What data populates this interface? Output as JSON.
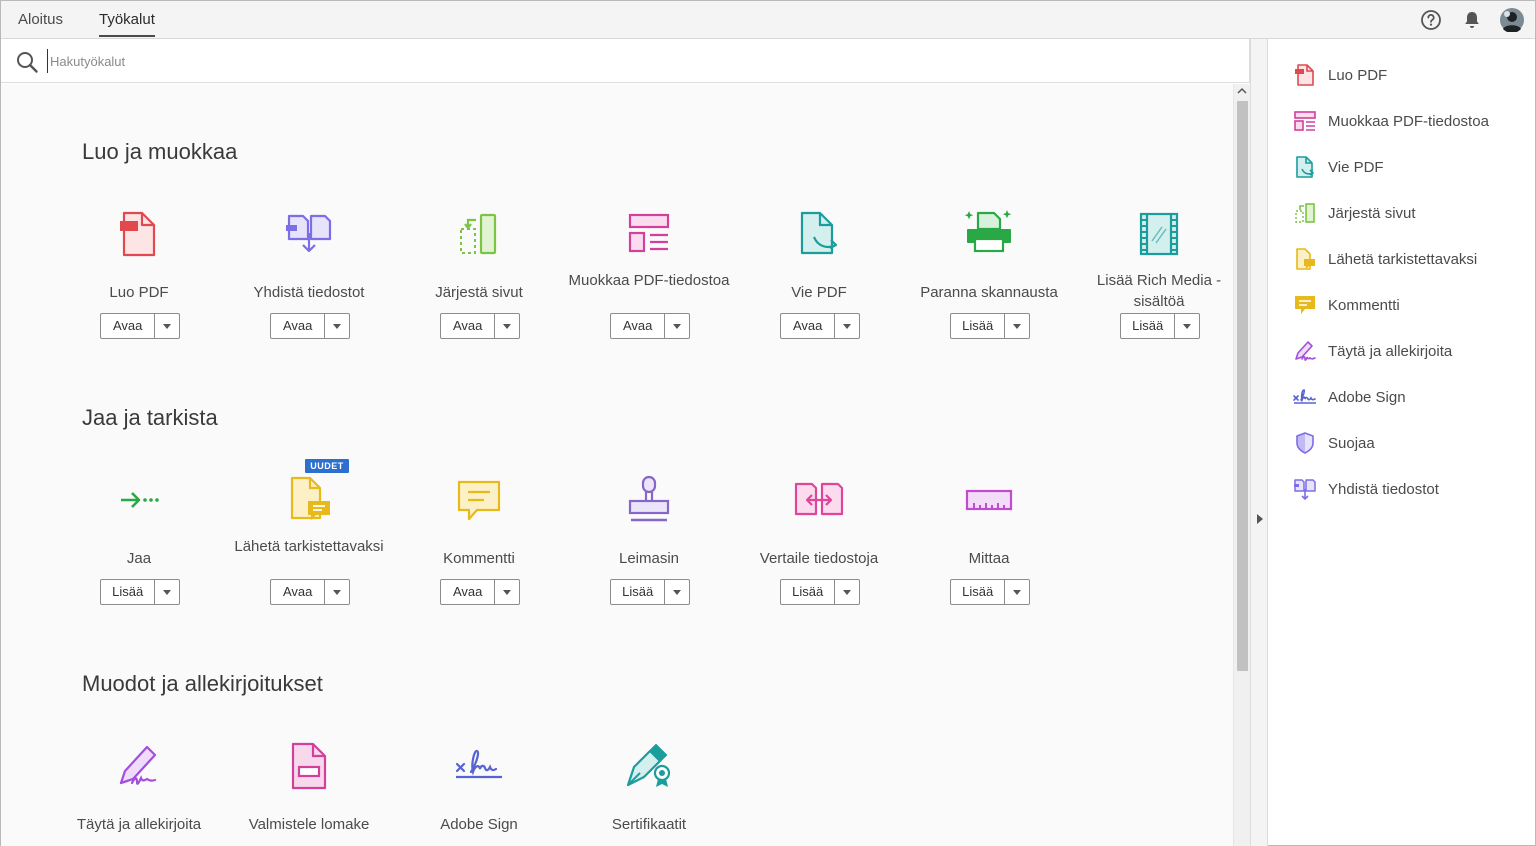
{
  "tabs": {
    "home": "Aloitus",
    "tools": "Työkalut"
  },
  "search": {
    "placeholder": "Hakutyökalut"
  },
  "sections": [
    {
      "title": "Luo ja muokkaa",
      "tools": [
        {
          "name": "Luo PDF",
          "button": "Avaa",
          "icon": "create-pdf-icon"
        },
        {
          "name": "Yhdistä tiedostot",
          "button": "Avaa",
          "icon": "combine-files-icon"
        },
        {
          "name": "Järjestä sivut",
          "button": "Avaa",
          "icon": "organize-pages-icon"
        },
        {
          "name": "Muokkaa PDF-tiedostoa",
          "button": "Avaa",
          "icon": "edit-pdf-icon"
        },
        {
          "name": "Vie PDF",
          "button": "Avaa",
          "icon": "export-pdf-icon"
        },
        {
          "name": "Paranna skannausta",
          "button": "Lisää",
          "icon": "enhance-scan-icon"
        },
        {
          "name": "Lisää Rich Media -sisältöä",
          "button": "Lisää",
          "icon": "rich-media-icon"
        }
      ]
    },
    {
      "title": "Jaa ja tarkista",
      "tools": [
        {
          "name": "Jaa",
          "button": "Lisää",
          "icon": "share-icon"
        },
        {
          "name": "Lähetä tarkistettavaksi",
          "button": "Avaa",
          "icon": "send-review-icon",
          "badge": "UUDET"
        },
        {
          "name": "Kommentti",
          "button": "Avaa",
          "icon": "comment-icon"
        },
        {
          "name": "Leimasin",
          "button": "Lisää",
          "icon": "stamp-icon"
        },
        {
          "name": "Vertaile tiedostoja",
          "button": "Lisää",
          "icon": "compare-files-icon"
        },
        {
          "name": "Mittaa",
          "button": "Lisää",
          "icon": "measure-icon"
        }
      ]
    },
    {
      "title": "Muodot ja allekirjoitukset",
      "tools": [
        {
          "name": "Täytä ja allekirjoita",
          "icon": "fill-sign-icon"
        },
        {
          "name": "Valmistele lomake",
          "icon": "prepare-form-icon"
        },
        {
          "name": "Adobe Sign",
          "icon": "adobe-sign-icon"
        },
        {
          "name": "Sertifikaatit",
          "icon": "certificates-icon"
        }
      ]
    }
  ],
  "right_panel": [
    {
      "label": "Luo PDF",
      "icon": "create-pdf-icon"
    },
    {
      "label": "Muokkaa PDF-tiedostoa",
      "icon": "edit-pdf-icon"
    },
    {
      "label": "Vie PDF",
      "icon": "export-pdf-icon"
    },
    {
      "label": "Järjestä sivut",
      "icon": "organize-pages-icon"
    },
    {
      "label": "Lähetä tarkistettavaksi",
      "icon": "send-review-icon"
    },
    {
      "label": "Kommentti",
      "icon": "comment-icon"
    },
    {
      "label": "Täytä ja allekirjoita",
      "icon": "fill-sign-icon"
    },
    {
      "label": "Adobe Sign",
      "icon": "adobe-sign-icon"
    },
    {
      "label": "Suojaa",
      "icon": "protect-icon"
    },
    {
      "label": "Yhdistä tiedostot",
      "icon": "combine-files-icon"
    }
  ],
  "colors": {
    "red": "#e04a4f",
    "purple": "#7b6ee6",
    "green": "#7cc444",
    "magenta": "#d1409b",
    "teal": "#1b9d9c",
    "scan_green": "#2aa845",
    "yellow": "#e8b91a",
    "stamp": "#8666c8",
    "pink": "#e0459a",
    "violet": "#a34fdb",
    "sign_blue": "#5763d3",
    "accent_blue": "#2d6fce"
  }
}
